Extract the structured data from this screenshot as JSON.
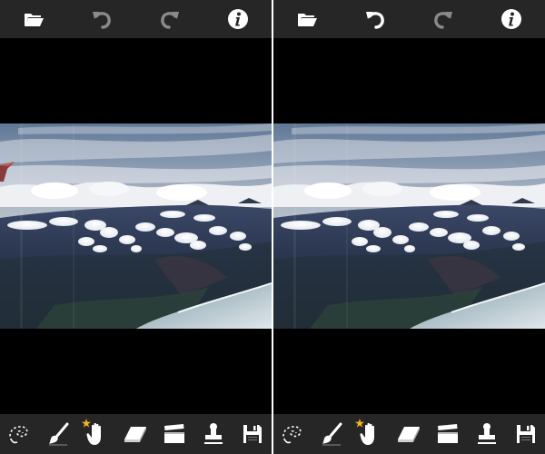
{
  "colors": {
    "toolbar_bg": "#262626",
    "canvas_bg": "#000000",
    "icon_white": "#ffffff",
    "icon_disabled": "#8a8a8a",
    "star_gold": "#f3b51c"
  },
  "screens": [
    {
      "id": "before",
      "top_toolbar": [
        {
          "icon": "folder-icon",
          "state": "enabled"
        },
        {
          "icon": "undo-icon",
          "state": "disabled"
        },
        {
          "icon": "redo-icon",
          "state": "disabled"
        },
        {
          "icon": "info-icon",
          "state": "enabled"
        }
      ],
      "photo": {
        "subject": "aerial-clouds-coastline",
        "wing_tip": "visible"
      },
      "bottom_toolbar": [
        {
          "icon": "lasso-icon"
        },
        {
          "icon": "brush-icon"
        },
        {
          "icon": "hand-icon",
          "badge": "star-icon"
        },
        {
          "icon": "eraser-icon"
        },
        {
          "icon": "clapperboard-icon"
        },
        {
          "icon": "stamp-icon"
        },
        {
          "icon": "save-icon"
        }
      ]
    },
    {
      "id": "after",
      "top_toolbar": [
        {
          "icon": "folder-icon",
          "state": "enabled"
        },
        {
          "icon": "undo-icon",
          "state": "enabled"
        },
        {
          "icon": "redo-icon",
          "state": "disabled"
        },
        {
          "icon": "info-icon",
          "state": "enabled"
        }
      ],
      "photo": {
        "subject": "aerial-clouds-coastline",
        "wing_tip": "removed"
      },
      "bottom_toolbar": [
        {
          "icon": "lasso-icon"
        },
        {
          "icon": "brush-icon"
        },
        {
          "icon": "hand-icon",
          "badge": "star-icon"
        },
        {
          "icon": "eraser-icon"
        },
        {
          "icon": "clapperboard-icon"
        },
        {
          "icon": "stamp-icon"
        },
        {
          "icon": "save-icon"
        }
      ]
    }
  ]
}
